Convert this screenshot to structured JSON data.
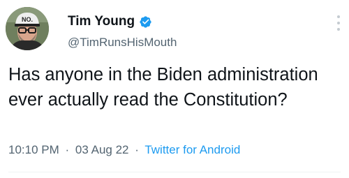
{
  "author": {
    "display_name": "Tim Young",
    "handle": "@TimRunsHisMouth",
    "verified_icon": "verified-badge-icon",
    "avatar_cap_text": "NO.",
    "badge_color": "#1d9bf0"
  },
  "tweet": {
    "text": "Has anyone in the Biden administration ever actually read the Constitution?",
    "time": "10:10 PM",
    "date": "03 Aug 22",
    "source": "Twitter for Android",
    "separator": "·"
  },
  "colors": {
    "text": "#0f1419",
    "muted": "#536471",
    "link": "#1d9bf0"
  }
}
